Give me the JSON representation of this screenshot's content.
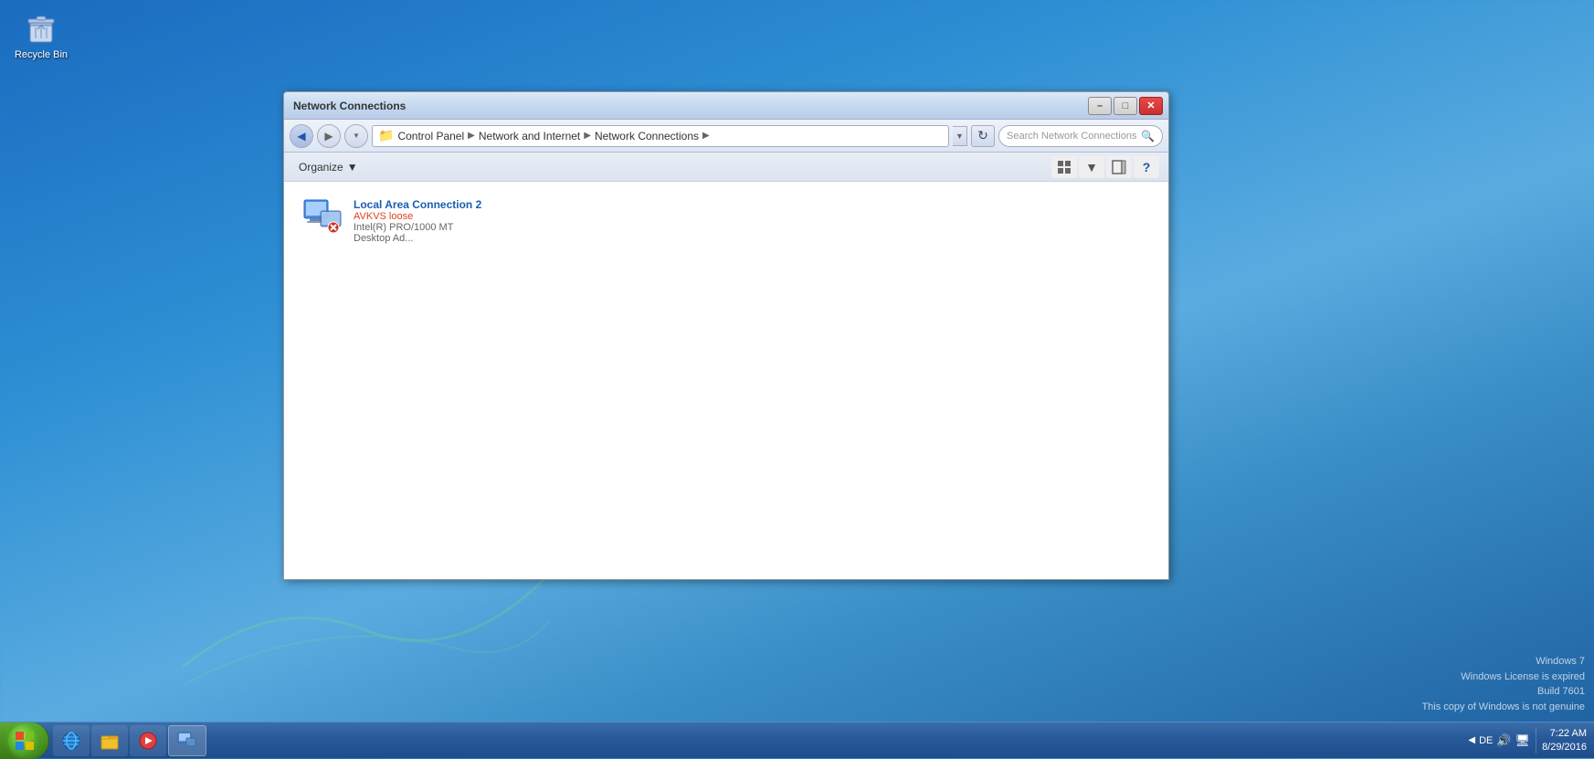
{
  "desktop": {
    "recycle_bin_label": "Recycle Bin"
  },
  "window": {
    "title": "Network Connections",
    "breadcrumb": {
      "parts": [
        "Control Panel",
        "Network and Internet",
        "Network Connections"
      ]
    },
    "search_placeholder": "Search Network Connections",
    "toolbar": {
      "organize_label": "Organize",
      "organize_arrow": "▼"
    },
    "connection": {
      "name": "Local Area Connection 2",
      "status": "AVKVS loose",
      "adapter": "Intel(R) PRO/1000 MT Desktop Ad...",
      "icon": "network-connection-icon"
    }
  },
  "title_bar_buttons": {
    "minimize": "–",
    "maximize": "□",
    "close": "✕"
  },
  "taskbar": {
    "start_label": "⊞",
    "items": [
      {
        "icon": "🌐",
        "name": "internet-explorer"
      },
      {
        "icon": "📁",
        "name": "file-explorer"
      },
      {
        "icon": "▶",
        "name": "media-player"
      },
      {
        "icon": "🖥",
        "name": "network-connections"
      }
    ],
    "tray": {
      "language": "DE",
      "time_line1": "7:22 AM",
      "time_line2": "8/29/2016"
    }
  },
  "watermark": {
    "line1": "Windows 7",
    "line2": "Windows License is expired",
    "line3": "Build 7601",
    "line4": "This copy of Windows is not genuine"
  }
}
